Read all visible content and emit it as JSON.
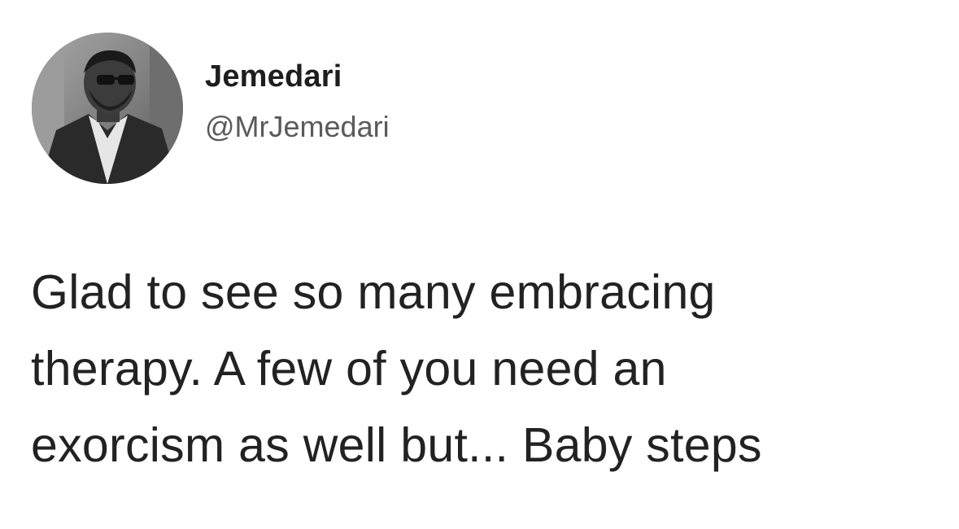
{
  "tweet": {
    "author": {
      "display_name": "Jemedari",
      "handle": "@MrJemedari",
      "avatar_icon": "profile-photo"
    },
    "text_lines": [
      "Glad to see so many embracing",
      "therapy. A few of you need an",
      "exorcism as well but... Baby steps"
    ]
  },
  "colors": {
    "background": "#ffffff",
    "text": "#222222",
    "handle": "#5a5a5a"
  }
}
